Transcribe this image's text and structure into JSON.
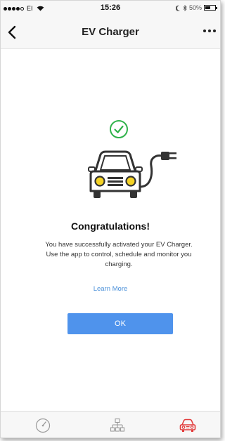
{
  "status_bar": {
    "carrier": "EI",
    "time": "15:26",
    "battery_text": "50%",
    "battery_level": 0.5
  },
  "nav": {
    "title": "EV Charger"
  },
  "content": {
    "heading": "Congratulations!",
    "message": "You have successfully activated your EV Charger. Use the app to control, schedule and monitor you charging.",
    "learn_more": "Learn More",
    "ok_label": "OK"
  },
  "colors": {
    "accent_green": "#2fb24a",
    "button_blue": "#4f93ec",
    "link_blue": "#4a90d9",
    "active_tab_red": "#e23b3b",
    "inactive_tab_gray": "#9a9a9a"
  },
  "icons": {
    "back": "chevron-left-icon",
    "more": "more-horizontal-icon",
    "success": "check-circle-icon",
    "illustration": "ev-car-plug-illustration",
    "tabs": [
      "speedometer-icon",
      "network-icon",
      "car-icon"
    ]
  },
  "tabs": [
    {
      "name": "dashboard",
      "active": false
    },
    {
      "name": "network",
      "active": false
    },
    {
      "name": "charger",
      "active": true
    }
  ]
}
